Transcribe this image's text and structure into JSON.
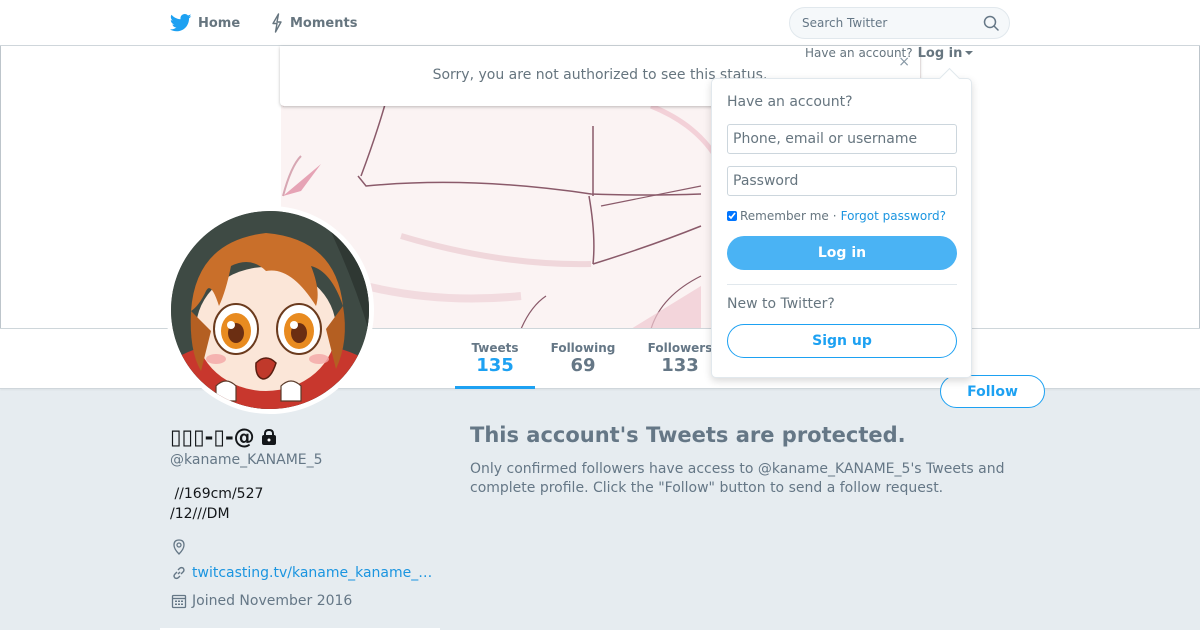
{
  "nav": {
    "home_label": "Home",
    "moments_label": "Moments",
    "search_placeholder": "Search Twitter"
  },
  "notice": {
    "text": "Sorry, you are not authorized to see this status.",
    "close_glyph": "×"
  },
  "login_prompt": {
    "text": "Have an account?",
    "link_label": "Log in"
  },
  "login_dropdown": {
    "heading": "Have an account?",
    "username_placeholder": "Phone, email or username",
    "password_placeholder": "Password",
    "remember_label": "Remember me",
    "separator": "·",
    "forgot_label": "Forgot password?",
    "login_button": "Log in",
    "new_heading": "New to Twitter?",
    "signup_button": "Sign up"
  },
  "profile_nav": {
    "stats": [
      {
        "label": "Tweets",
        "value": "135"
      },
      {
        "label": "Following",
        "value": "69"
      },
      {
        "label": "Followers",
        "value": "133"
      }
    ],
    "follow_button": "Follow"
  },
  "profile": {
    "name": "▯▯▯-▯-@",
    "screen_name": "@kaname_KANAME_5",
    "bio": " //169cm/527\n/12///DM",
    "location": "",
    "url_text": "twitcasting.tv/kaname_kaname_…",
    "joined": "Joined November 2016"
  },
  "protected": {
    "title": "This account's Tweets are protected.",
    "text": "Only confirmed followers have access to @kaname_KANAME_5's Tweets and complete profile. Click the \"Follow\" button to send a follow request."
  },
  "colors": {
    "brand_blue": "#1da1f2",
    "login_button_blue": "#4ab3f4",
    "page_background": "#e6ecf0",
    "muted_text": "#657786"
  },
  "icons": {
    "home": "twitter-bird-icon",
    "moments": "lightning-icon",
    "search": "search-icon",
    "lock": "lock-icon",
    "location": "location-pin-icon",
    "url": "link-icon",
    "joined": "calendar-icon"
  }
}
